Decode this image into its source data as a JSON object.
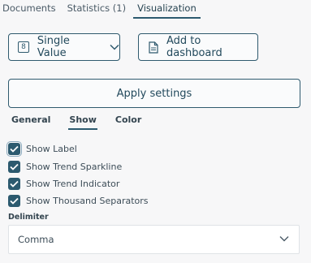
{
  "top_tabs": [
    {
      "label": "Documents"
    },
    {
      "label": "Statistics (1)"
    },
    {
      "label": "Visualization",
      "active": true
    }
  ],
  "toolbar": {
    "type_icon_glyph": "8",
    "type_icon": "single-value-icon",
    "type_label": "Single Value",
    "dashboard_icon": "document-icon",
    "dashboard_label": "Add to dashboard"
  },
  "apply_label": "Apply settings",
  "sub_tabs": [
    {
      "label": "General"
    },
    {
      "label": "Show",
      "active": true
    },
    {
      "label": "Color"
    }
  ],
  "show_options": [
    {
      "label": "Show Label",
      "checked": true
    },
    {
      "label": "Show Trend Sparkline",
      "checked": true
    },
    {
      "label": "Show Trend Indicator",
      "checked": true
    },
    {
      "label": "Show Thousand Separators",
      "checked": true
    }
  ],
  "delimiter": {
    "label": "Delimiter",
    "value": "Comma"
  },
  "colors": {
    "accent": "#2c5a6f",
    "background": "#f7f7f8"
  }
}
